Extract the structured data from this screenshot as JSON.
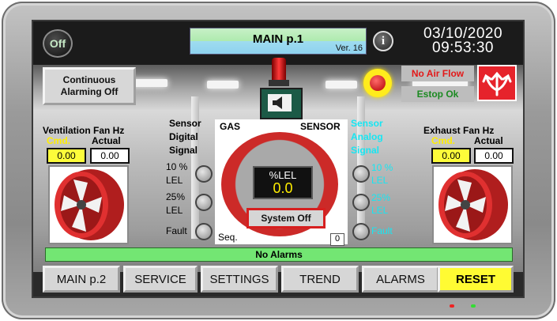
{
  "header": {
    "power_button_label": "Off",
    "title": "MAIN p.1",
    "version": "Ver. 16",
    "info_icon": "info-icon",
    "date": "03/10/2020",
    "time": "09:53:30"
  },
  "controls": {
    "continuous_alarming": "Continuous Alarming Off",
    "no_air_flow": "No Air Flow",
    "estop_ok": "Estop Ok",
    "estop_lamp_color": "#d40000",
    "airflow_icon": "airflow-arrows-icon",
    "horn_icon": "speaker-icon"
  },
  "ventilation": {
    "title": "Ventilation Fan Hz",
    "cmd_label": "Cmd.",
    "actual_label": "Actual",
    "cmd_value": "0.00",
    "actual_value": "0.00"
  },
  "exhaust": {
    "title": "Exhaust Fan Hz",
    "cmd_label": "Cmd.",
    "actual_label": "Actual",
    "cmd_value": "0.00",
    "actual_value": "0.00"
  },
  "digital_signal": {
    "title_line1": "Sensor",
    "title_line2": "Digital",
    "title_line3": "Signal",
    "items": [
      "10 %",
      "LEL",
      "25%",
      "LEL",
      "Fault"
    ]
  },
  "analog_signal": {
    "title_line1": "Sensor",
    "title_line2": "Analog",
    "title_line3": "Signal",
    "items": [
      "10 %",
      "LEL",
      "25%",
      "LEL",
      "Fault"
    ]
  },
  "sensor": {
    "gas_label": "GAS",
    "sensor_label": "SENSOR",
    "unit": "%LEL",
    "value": "0.0",
    "status": "System Off",
    "seq_label": "Seq.",
    "seq_value": "0"
  },
  "alarm_bar": "No Alarms",
  "nav": {
    "main2": "MAIN p.2",
    "service": "SERVICE",
    "settings": "SETTINGS",
    "trend": "TREND",
    "alarms": "ALARMS",
    "reset": "RESET"
  },
  "colors": {
    "accent_green": "#73e673",
    "alarm_red": "#e31919",
    "reset_yellow": "#fffb33",
    "analog_cyan": "#17e6f2"
  }
}
